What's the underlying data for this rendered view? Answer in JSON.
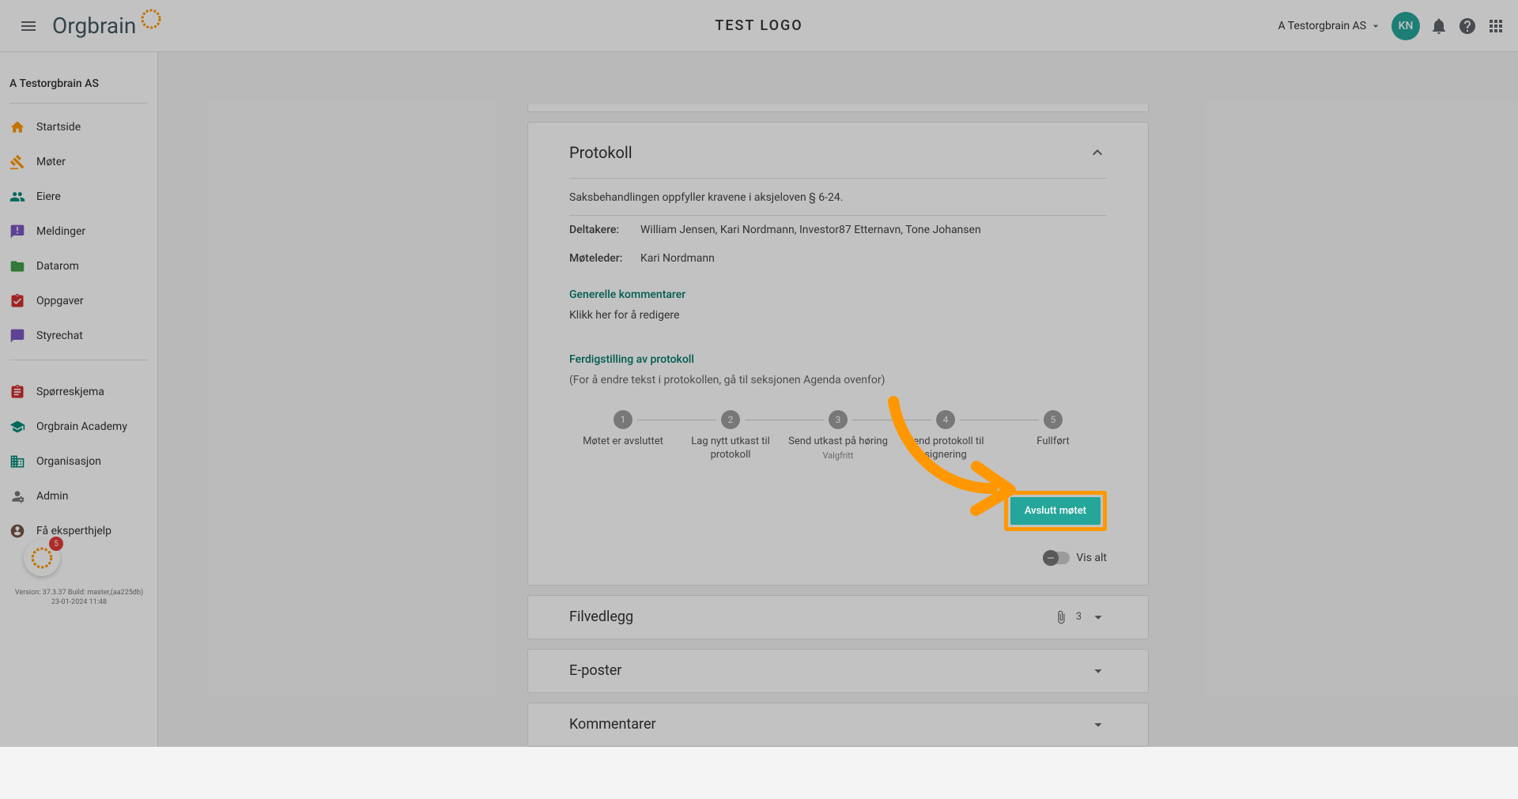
{
  "header": {
    "logo_text": "Orgbrain",
    "center_title": "TEST LOGO",
    "org_name": "A Testorgbrain AS",
    "avatar_initials": "KN"
  },
  "sidebar": {
    "org_title": "A Testorgbrain AS",
    "items": [
      {
        "label": "Startside",
        "icon": "home",
        "color": "#ff9800"
      },
      {
        "label": "Møter",
        "icon": "gavel",
        "color": "#ff9800"
      },
      {
        "label": "Eiere",
        "icon": "people",
        "color": "#00897b"
      },
      {
        "label": "Meldinger",
        "icon": "announcement",
        "color": "#7e57c2"
      },
      {
        "label": "Datarom",
        "icon": "folder",
        "color": "#43a047"
      },
      {
        "label": "Oppgaver",
        "icon": "task",
        "color": "#d32f2f"
      },
      {
        "label": "Styrechat",
        "icon": "chat",
        "color": "#7e57c2"
      }
    ],
    "items2": [
      {
        "label": "Spørreskjema",
        "icon": "clipboard",
        "color": "#d32f2f"
      },
      {
        "label": "Orgbrain Academy",
        "icon": "school",
        "color": "#00897b"
      },
      {
        "label": "Organisasjon",
        "icon": "business",
        "color": "#00897b"
      },
      {
        "label": "Admin",
        "icon": "admin",
        "color": "#757575"
      },
      {
        "label": "Få eksperthjelp",
        "icon": "help",
        "color": "#795548"
      }
    ],
    "fab_badge": "5",
    "version_line1": "Version: 37.3.37 Build: master,(aa225db)",
    "version_line2": "23-01-2024 11:48"
  },
  "protokoll": {
    "title": "Protokoll",
    "compliance_text": "Saksbehandlingen oppfyller kravene i aksjeloven § 6-24.",
    "participants_label": "Deltakere:",
    "participants": "William Jensen, Kari Nordmann, Investor87 Etternavn, Tone Johansen",
    "leader_label": "Møteleder:",
    "leader": "Kari Nordmann",
    "comments_heading": "Generelle kommentarer",
    "comments_placeholder": "Klikk her for å redigere",
    "finalize_heading": "Ferdigstilling av protokoll",
    "finalize_note": "(For å endre tekst i protokollen, gå til seksjonen Agenda ovenfor)",
    "steps": [
      {
        "num": "1",
        "label": "Møtet er avsluttet"
      },
      {
        "num": "2",
        "label": "Lag nytt utkast til protokoll"
      },
      {
        "num": "3",
        "label": "Send utkast på høring",
        "sublabel": "Valgfritt"
      },
      {
        "num": "4",
        "label": "Send protokoll til signering"
      },
      {
        "num": "5",
        "label": "Fullført"
      }
    ],
    "primary_button": "Avslutt møtet",
    "toggle_label": "Vis alt"
  },
  "collapsibles": {
    "attachments_title": "Filvedlegg",
    "attachments_count": "3",
    "emails_title": "E-poster",
    "comments_title": "Kommentarer"
  }
}
